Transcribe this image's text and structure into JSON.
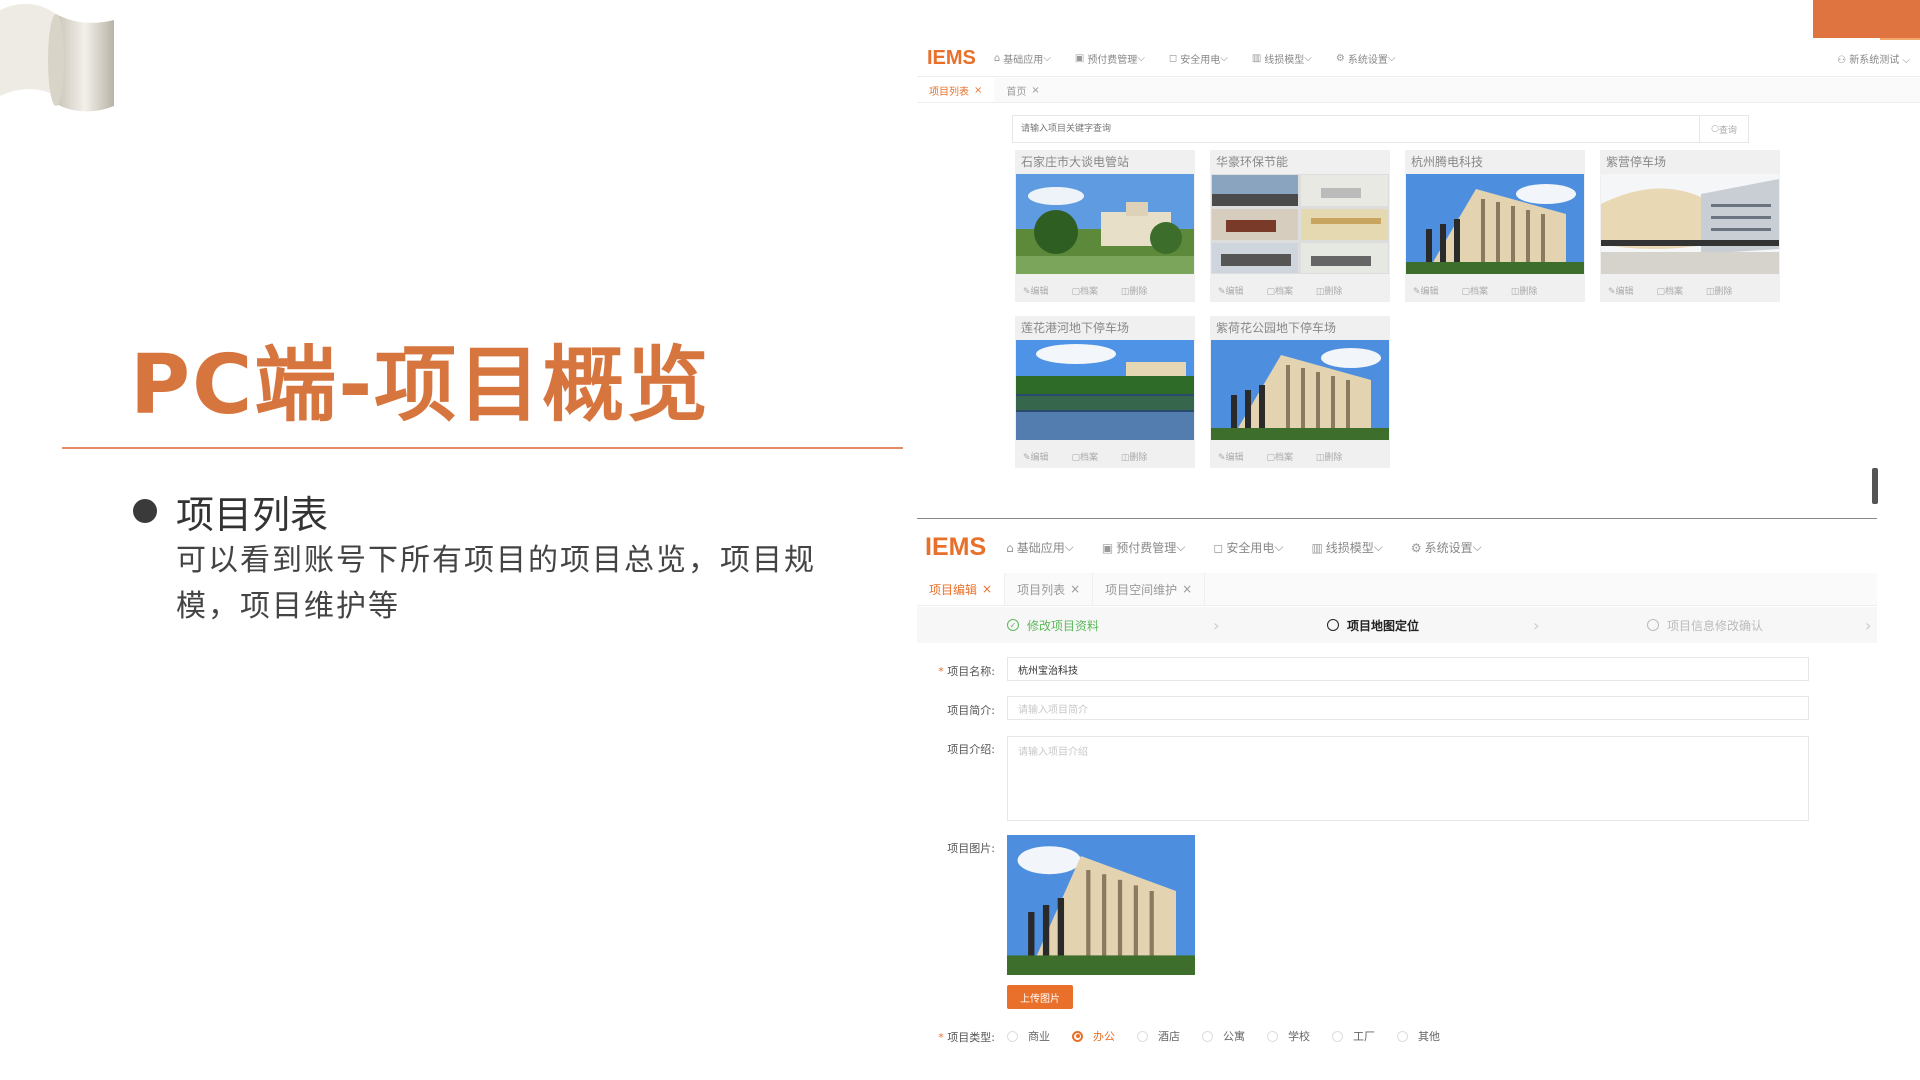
{
  "slide": {
    "title": "PC端-项目概览",
    "bullet_title": "项目列表",
    "bullet_desc": "可以看到账号下所有项目的项目总览，项目规模，项目维护等"
  },
  "app": {
    "logo": "IEMS",
    "nav": [
      "基础应用",
      "预付费管理",
      "安全用电",
      "线损模型",
      "系统设置"
    ],
    "nav_icons": [
      "home-icon",
      "wallet-icon",
      "shield-icon",
      "bar-chart-icon",
      "gear-icon"
    ],
    "user": "新系统测试",
    "accent_color": "#e8702a"
  },
  "list_view": {
    "tabs": [
      {
        "label": "项目列表",
        "active": true
      },
      {
        "label": "首页",
        "active": false
      }
    ],
    "search_placeholder": "请输入项目关键字查询",
    "search_button": "查询",
    "card_actions": [
      "编辑",
      "档案",
      "删除"
    ],
    "projects": [
      {
        "name": "石家庄市大谈电管站"
      },
      {
        "name": "华豪环保节能"
      },
      {
        "name": "杭州腾电科技"
      },
      {
        "name": "紫营停车场"
      },
      {
        "name": "莲花港河地下停车场"
      },
      {
        "name": "紫荷花公园地下停车场"
      }
    ]
  },
  "edit_view": {
    "tabs": [
      {
        "label": "项目编辑",
        "active": true
      },
      {
        "label": "项目列表",
        "active": false
      },
      {
        "label": "项目空间维护",
        "active": false
      }
    ],
    "steps": [
      "修改项目资料",
      "项目地图定位",
      "项目信息修改确认"
    ],
    "fields": {
      "name_label": "项目名称:",
      "name_value": "杭州宝治科技",
      "summary_label": "项目简介:",
      "summary_placeholder": "请输入项目简介",
      "intro_label": "项目介绍:",
      "intro_placeholder": "请输入项目介绍",
      "image_label": "项目图片:",
      "upload_button": "上传图片",
      "type_label": "项目类型:"
    },
    "project_types": [
      "商业",
      "办公",
      "酒店",
      "公寓",
      "学校",
      "工厂",
      "其他"
    ],
    "selected_type": "办公"
  }
}
